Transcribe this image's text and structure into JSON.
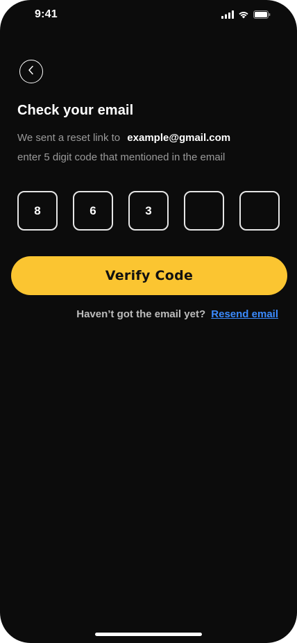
{
  "status_bar": {
    "time": "9:41",
    "icons": [
      "signal-icon",
      "wifi-icon",
      "battery-icon"
    ]
  },
  "nav": {
    "back_icon": "chevron-left-icon"
  },
  "content": {
    "title": "Check your email",
    "desc_prefix": "We sent a reset link to",
    "email": "example@gmail.com",
    "desc_line2": "enter 5 digit code that mentioned in the email"
  },
  "code": {
    "digits": [
      "8",
      "6",
      "3",
      "",
      ""
    ]
  },
  "actions": {
    "verify_label": "Verify Code",
    "resend_prompt": "Haven’t got the email yet?",
    "resend_link": "Resend email"
  },
  "colors": {
    "background": "#0c0c0c",
    "accent": "#fbc531",
    "link": "#3b8bff"
  }
}
